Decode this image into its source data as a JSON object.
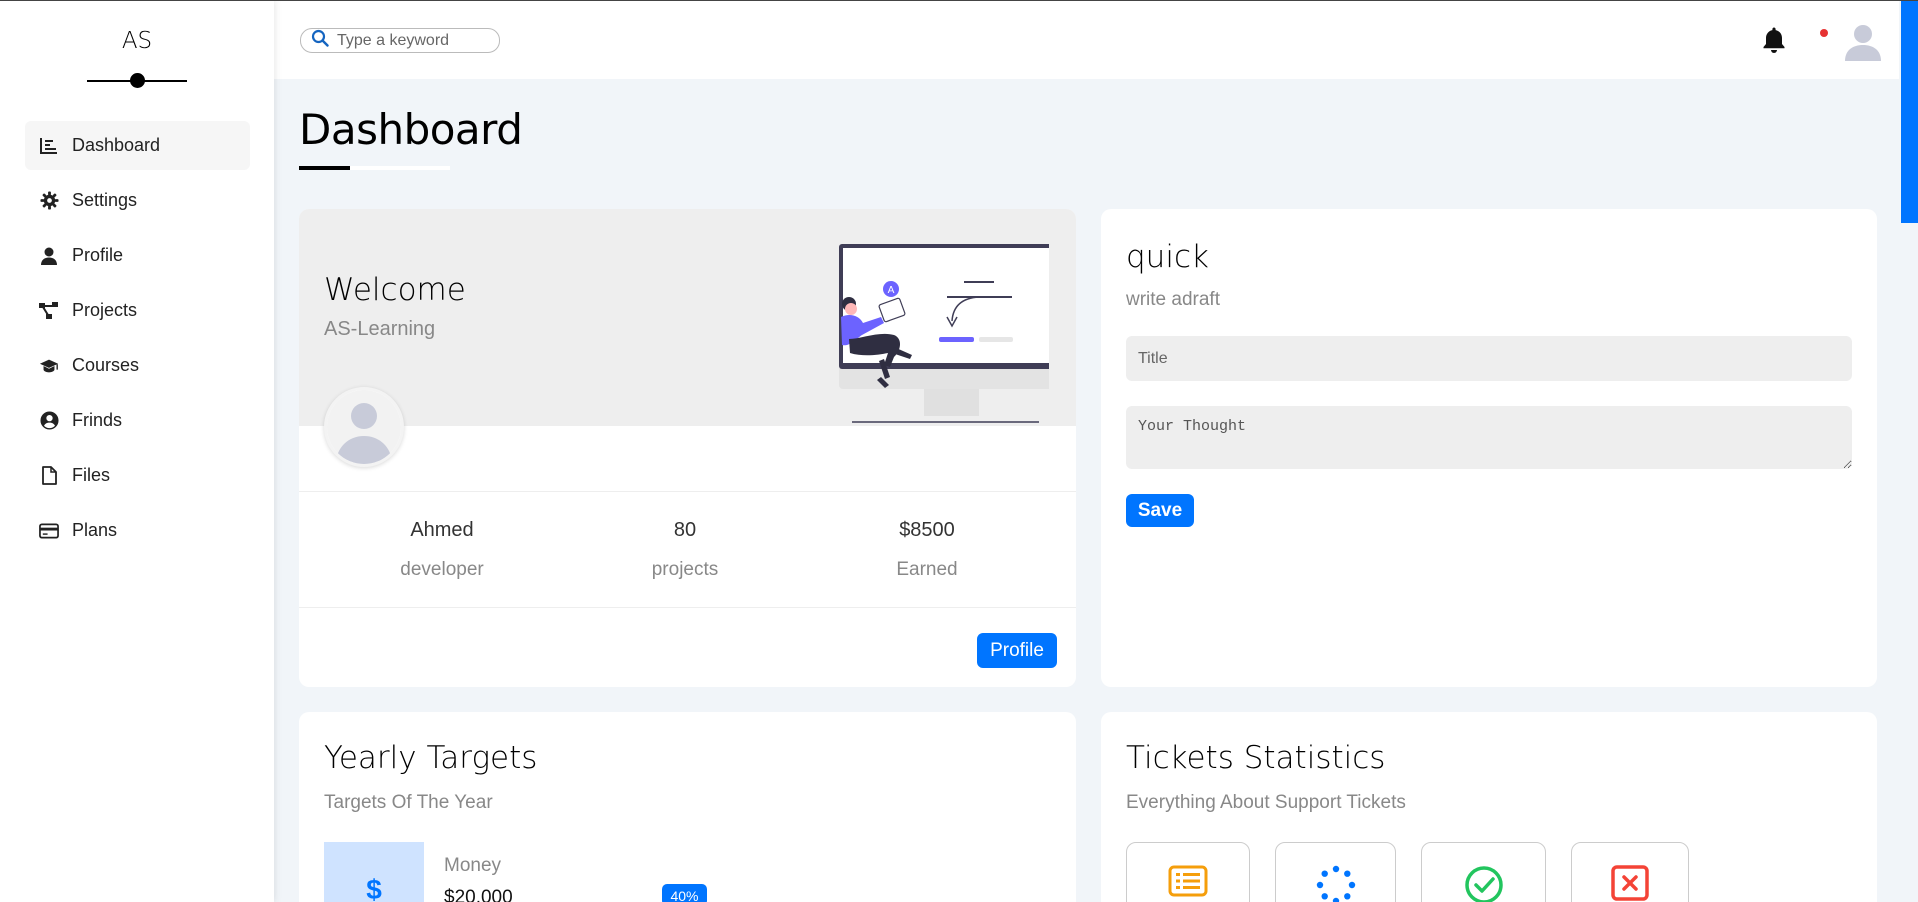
{
  "brand": {
    "logo": "AS"
  },
  "sidebar": {
    "items": [
      {
        "label": "Dashboard",
        "icon": "chart-icon",
        "active": true
      },
      {
        "label": "Settings",
        "icon": "gear-icon"
      },
      {
        "label": "Profile",
        "icon": "user-icon"
      },
      {
        "label": "Projects",
        "icon": "diagram-icon"
      },
      {
        "label": "Courses",
        "icon": "graduation-cap-icon"
      },
      {
        "label": "Frinds",
        "icon": "user-circle-icon"
      },
      {
        "label": "Files",
        "icon": "file-icon"
      },
      {
        "label": "Plans",
        "icon": "credit-card-icon"
      }
    ]
  },
  "header": {
    "search_placeholder": "Type a keyword",
    "notification_color": "#e63232"
  },
  "page": {
    "title": "Dashboard"
  },
  "welcome": {
    "title": "Welcome",
    "subtitle": "AS-Learning",
    "stats": [
      {
        "value": "Ahmed",
        "label": "developer"
      },
      {
        "value": "80",
        "label": "projects"
      },
      {
        "value": "$8500",
        "label": "Earned"
      }
    ],
    "button": "Profile"
  },
  "quick": {
    "title": "quick",
    "subtitle": "write adraft",
    "title_placeholder": "Title",
    "thought_placeholder": "Your Thought",
    "save_label": "Save"
  },
  "yearly": {
    "title": "Yearly Targets",
    "subtitle": "Targets Of The Year",
    "money": {
      "icon_glyph": "$",
      "label": "Money",
      "value": "$20,000",
      "progress": "40%"
    }
  },
  "tickets": {
    "title": "Tickets Statistics",
    "subtitle": "Everything About Support Tickets",
    "boxes": [
      {
        "icon": "list-icon",
        "color": "#f59e0b"
      },
      {
        "icon": "spinner-icon",
        "color": "#0075ff"
      },
      {
        "icon": "check-circle-icon",
        "color": "#22c55e"
      },
      {
        "icon": "close-square-icon",
        "color": "#f44336"
      }
    ]
  },
  "colors": {
    "accent": "#0075ff",
    "background": "#f1f5f9"
  }
}
